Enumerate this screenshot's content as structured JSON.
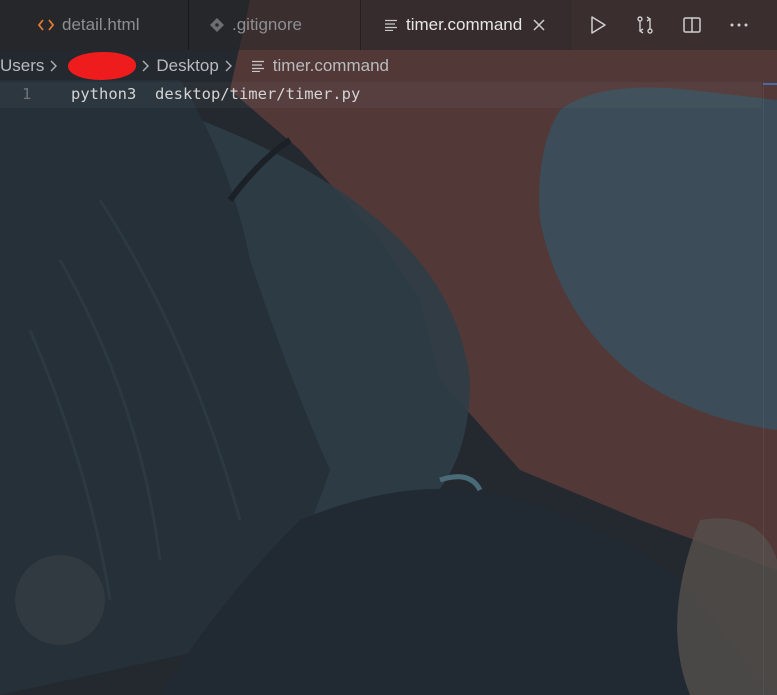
{
  "tabs": [
    {
      "label": "detail.html",
      "icon": "html-code-icon",
      "active": false
    },
    {
      "label": ".gitignore",
      "icon": "git-icon",
      "active": false
    },
    {
      "label": "timer.command",
      "icon": "lines-file-icon",
      "active": true
    }
  ],
  "actions": [
    "run-icon",
    "compare-changes-icon",
    "split-editor-icon",
    "more-icon"
  ],
  "breadcrumb": {
    "items": [
      "Users",
      "Desktop",
      "timer.command"
    ]
  },
  "editor": {
    "line_number": "1",
    "code": "python3  desktop/timer/timer.py"
  },
  "colors": {
    "html_icon": "#e37933",
    "active_tab_text": "#e6e6e6",
    "inactive_tab_text": "#8d8f92",
    "redaction": "#ee1c1c",
    "scroll_marker": "#4b6aa8"
  }
}
